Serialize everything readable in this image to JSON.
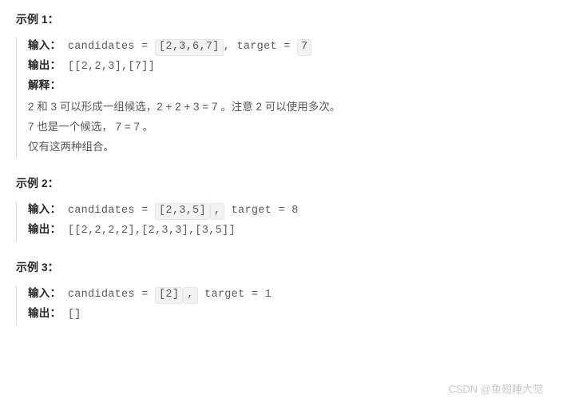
{
  "examples": [
    {
      "heading": "示例 1：",
      "input_label": "输入：",
      "input_prefix": "candidates = ",
      "input_candidates": "[2,3,6,7]",
      "input_comma": ",",
      "input_target_prefix": " target = ",
      "input_target": "7",
      "output_label": "输出：",
      "output_value": "[[2,2,3],[7]]",
      "explain_label": "解释：",
      "explain_lines": [
        "2 和 3 可以形成一组候选，2 + 2 + 3 = 7 。注意 2 可以使用多次。",
        "7 也是一个候选， 7 = 7 。",
        "仅有这两种组合。"
      ]
    },
    {
      "heading": "示例 2：",
      "input_label": "输入：",
      "input_prefix": "candidates = ",
      "input_candidates": "[2,3,5]",
      "input_comma": ",",
      "input_target_prefix": " target = ",
      "input_target": "8",
      "output_label": "输出：",
      "output_value": "[[2,2,2,2],[2,3,3],[3,5]]"
    },
    {
      "heading": "示例 3：",
      "input_label": "输入：",
      "input_prefix": "candidates = ",
      "input_candidates": "[2]",
      "input_comma": ",",
      "input_target_prefix": " target = ",
      "input_target": "1",
      "output_label": "输出：",
      "output_value": "[]"
    }
  ],
  "watermark": "CSDN @鱼翅睡大觉"
}
